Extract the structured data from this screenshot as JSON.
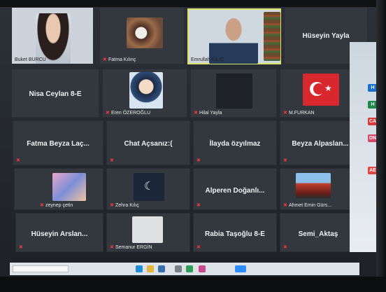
{
  "participants": [
    {
      "id": "p1",
      "label": "Buket BURCU",
      "video": "person"
    },
    {
      "id": "p2",
      "label": "Fatma Kılınç",
      "video": "image"
    },
    {
      "id": "p3",
      "label": "Emrullah KILIÇ",
      "video": "person"
    },
    {
      "id": "p4",
      "label": "Hüseyin Yayla",
      "video": "none"
    },
    {
      "id": "p5",
      "label": "Nisa Ceylan 8-E",
      "video": "none"
    },
    {
      "id": "p6",
      "label": "Eren ÖZEROĞLU",
      "video": "image"
    },
    {
      "id": "p7",
      "label": "Hilal Yayla",
      "video": "image"
    },
    {
      "id": "p8",
      "label": "M.FURKAN",
      "video": "image"
    },
    {
      "id": "p9",
      "label": "Fatma Beyza Laç...",
      "video": "none"
    },
    {
      "id": "p10",
      "label": "Chat Açsanız:(",
      "video": "none"
    },
    {
      "id": "p11",
      "label": "İlayda özyılmaz",
      "video": "none"
    },
    {
      "id": "p12",
      "label": "Beyza Alpaslan...",
      "video": "none"
    },
    {
      "id": "p13",
      "label": "zeynep çetin",
      "video": "image"
    },
    {
      "id": "p14",
      "label": "Zehra Kılıç",
      "video": "image"
    },
    {
      "id": "p15",
      "label": "Alperen Doğanlı...",
      "video": "none"
    },
    {
      "id": "p16",
      "label": "Ahmet Emin Gürs...",
      "video": "image"
    },
    {
      "id": "p17",
      "label": "Hüseyin Arslan...",
      "video": "none"
    },
    {
      "id": "p18",
      "label": "Semanur ERGİN",
      "video": "image"
    },
    {
      "id": "p19",
      "label": "Rabia Taşoğlu 8-E",
      "video": "none"
    },
    {
      "id": "p20",
      "label": "Semi_Aktaş",
      "video": "none"
    }
  ],
  "side_apps": [
    "H",
    "H",
    "CA",
    "DN",
    "AE"
  ],
  "muted_icon": "mic-muted-icon",
  "active_speaker_color": "#d9e36a"
}
